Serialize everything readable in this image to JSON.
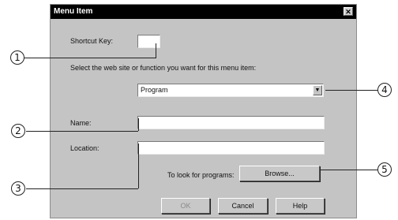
{
  "dialog": {
    "title": "Menu Item",
    "close_glyph": "✕",
    "shortcut_label": "Shortcut Key:",
    "shortcut_value": "",
    "instruction": "Select the web site or function you want for this menu item:",
    "function_selected": "Program",
    "combo_arrow_glyph": "▼",
    "name_label": "Name:",
    "name_value": "",
    "location_label": "Location:",
    "location_value": "",
    "programs_label": "To look for programs:",
    "browse_label": "Browse...",
    "ok_label": "OK",
    "cancel_label": "Cancel",
    "help_label": "Help"
  },
  "callouts": [
    "1",
    "2",
    "3",
    "4",
    "5"
  ]
}
